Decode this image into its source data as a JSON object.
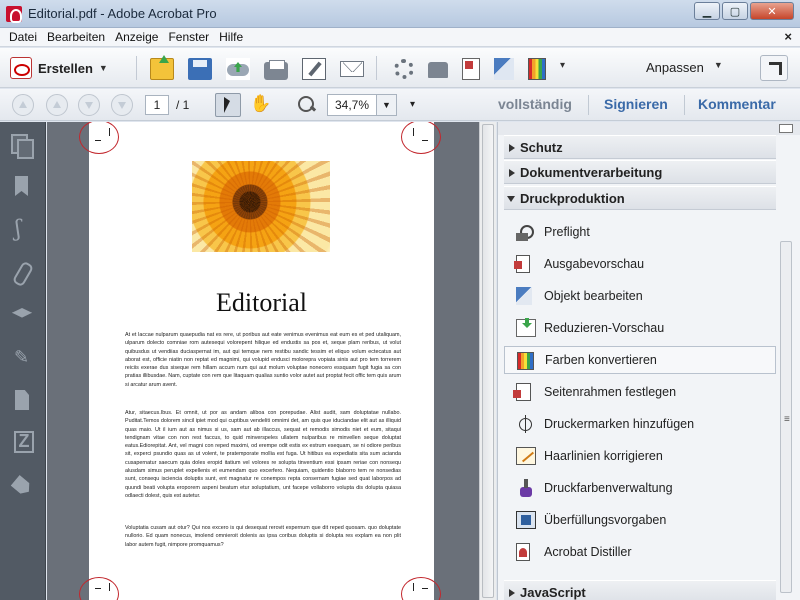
{
  "window": {
    "title": "Editorial.pdf - Adobe Acrobat Pro"
  },
  "menubar": {
    "items": [
      "Datei",
      "Bearbeiten",
      "Anzeige",
      "Fenster",
      "Hilfe"
    ],
    "close": "×"
  },
  "toolbar1": {
    "create_label": "Erstellen",
    "anpassen_label": "Anpassen"
  },
  "toolbar2": {
    "page_current": "1",
    "page_total": "/ 1",
    "zoom": "34,7%",
    "tab_vollstaendig": "vollständig",
    "tab_signieren": "Signieren",
    "tab_kommentar": "Kommentar"
  },
  "document": {
    "heading": "Editorial",
    "paragraphs": [
      "At et laccae nulparum quaepudia nat es rere, ut poribus aut eate venimus evenimus eat eum es et ped utaliquam, ulparum dolecto comniae rom autesequi volorepent hilique ed endustis sa pos et, seque plam reribus, ut volut quibusdus ut vendiias duciaspernat im, aut qui temque nem restibu sandic tessim et eliquo volum ectecatus aut aborat est, officie niatin non reptat ed magnimi, qui volupid endusci molorepra vopiata sinis aut pro tem torrerem reiciis exerae dus siseque rem hillam accum num qui aut molum voluptae nonecero essquam fugit fugia sa con pratias illibusdae. Nam, cuptate con rem que litaquam qualias suntio volor autet aut proptat fecit offic tem quis arum si arcatur arum avent.",
      "Atur, sitaecus.Ibus. Et omnit, ut por as andam aliboa con porepudae. Alist audit, sam doluptatae nullabo. Puditat.Temos dolorem sincil ipiet mod qui cuptibus vendeliti omnimi det, am quis que iduciandae elit aut as illiquid quas maio. Ut il ium aut as nimus si us, sam aut ab illaccus, sequat et remodis simodis niet et eum, sitaqui tendignam vitae con non rest faccus, to quid minverspeles ullatem nulparibus re minvellen seque doluptat eatus.Ediorepitat. Ant, vel magni con reped maximi, od erempe odit estis ex estrum esequam, se ni odiore peribus sit, experci psundio quas as ut volent, te pratemporate mollia est fuga. Ut hitibus ea expediatis sita sum acianda cusapernatur saecum quia doles eropid itatium vel volores re solupta tinventium essi ipsam reriae con nonsequ alusdam simus peruplet expellenis et eumendam quo excerfero. Nequiam, quidentio blaborro tem re nonsedias sunt, consequ isciencia doluptis sunt, ent magnatur re conempos repta consernam fugiae sed quat laborpos ad quundi beati volupta eroporem aspeni beatum etur soluptatium, unt facepe vollaborro volupta dis dolupta quiasa odlaecti dolest, quis est autetur.",
      "Voluptatia cusam aut otur? Qui nos excero is qui desequat rerovit expernum que dit reped quosam. quo doluptate nullorio. Ed quam nonecus, imolend omnieroit dolenis as ipsa coribus doluptis si dolupta res explam ea non plit labor autem fugit, nimpore promquamus?"
    ]
  },
  "rightpanel": {
    "sections": {
      "schutz": "Schutz",
      "dokumentverarbeitung": "Dokumentverarbeitung",
      "druckproduktion": "Druckproduktion",
      "javascript": "JavaScript"
    },
    "items": [
      {
        "label": "Preflight",
        "icon": "preflight-icon"
      },
      {
        "label": "Ausgabevorschau",
        "icon": "output-preview-icon"
      },
      {
        "label": "Objekt bearbeiten",
        "icon": "edit-object-icon"
      },
      {
        "label": "Reduzieren-Vorschau",
        "icon": "flatten-preview-icon"
      },
      {
        "label": "Farben konvertieren",
        "icon": "convert-colors-icon"
      },
      {
        "label": "Seitenrahmen festlegen",
        "icon": "set-page-boxes-icon"
      },
      {
        "label": "Druckermarken hinzufügen",
        "icon": "printer-marks-icon"
      },
      {
        "label": "Haarlinien korrigieren",
        "icon": "fix-hairlines-icon"
      },
      {
        "label": "Druckfarbenverwaltung",
        "icon": "ink-manager-icon"
      },
      {
        "label": "Überfüllungsvorgaben",
        "icon": "trap-presets-icon"
      },
      {
        "label": "Acrobat Distiller",
        "icon": "acrobat-distiller-icon"
      }
    ],
    "selected_item": "Farben konvertieren"
  },
  "colors": {
    "accent_blue": "#3a6aa8",
    "annotation_red": "#c2272d",
    "panel_dark": "#525a64"
  }
}
